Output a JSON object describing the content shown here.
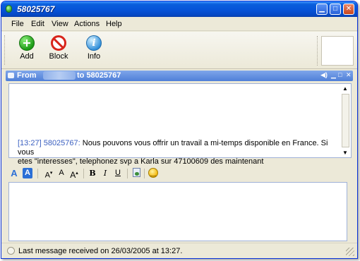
{
  "window": {
    "title": "58025767"
  },
  "menu": [
    "File",
    "Edit",
    "View",
    "Actions",
    "Help"
  ],
  "toolbar": {
    "add_label": "Add",
    "block_label": "Block",
    "info_label": "Info"
  },
  "conversation": {
    "header_from": "From",
    "header_to": "to 58025767",
    "message": {
      "timestamp": "[13:27]",
      "sender": "58025767:",
      "text_line1": "Nous pouvons vous offrir un travail a mi-temps disponible  en France. Si vous",
      "text_line2": "etes \"interesses\", telephonez svp a Karla sur 47100609 des maintenant"
    }
  },
  "format_bar": {
    "font_label": "A",
    "color_label": "A",
    "shrink_label": "A",
    "normal_label": "A",
    "grow_label": "A",
    "bold_label": "B",
    "italic_label": "I",
    "underline_label": "U"
  },
  "status": {
    "text": "Last message received on 26/03/2005 at 13:27."
  },
  "colors": {
    "title_bar": "#0653d8",
    "conversation_header": "#4f7fd8",
    "timestamp": "#3a5fc0"
  }
}
